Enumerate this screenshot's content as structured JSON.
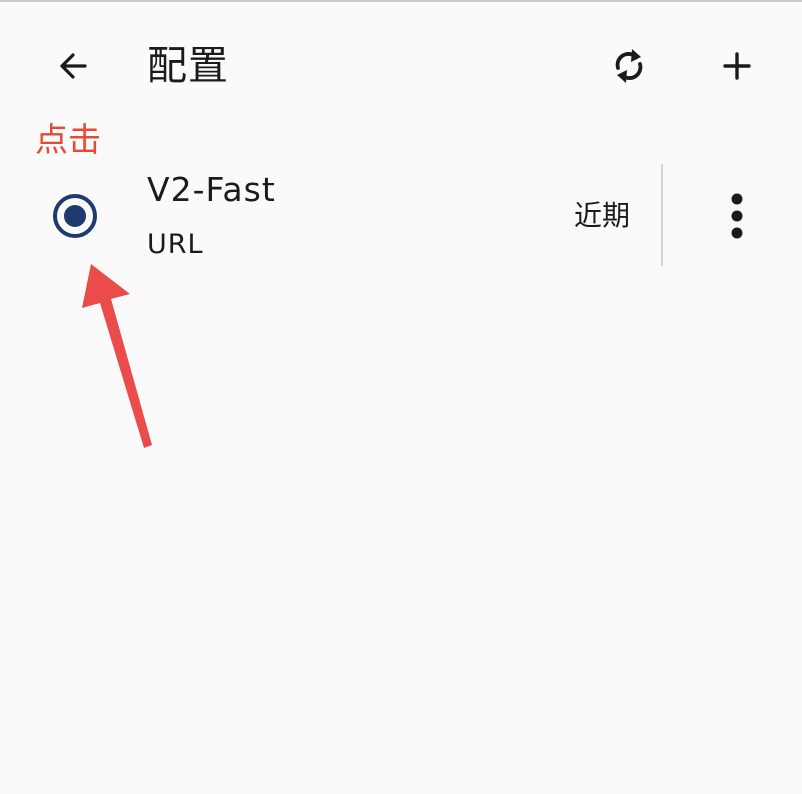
{
  "app_bar": {
    "title": "配置",
    "back_icon": "arrow-left-icon",
    "sync_icon": "sync-icon",
    "add_icon": "plus-icon"
  },
  "annotation": {
    "label": "点击",
    "color": "#e64a32",
    "arrow_icon": "annotation-arrow"
  },
  "profiles": [
    {
      "name": "V2-Fast",
      "type": "URL",
      "updated": "近期",
      "selected": true,
      "radio_color": "#1e3a6e",
      "menu_icon": "more-vertical-icon"
    }
  ],
  "colors": {
    "background": "#fafafa",
    "text": "#1b1b1b",
    "divider": "#d4d4d4",
    "accent": "#1e3a6e",
    "annotation": "#e64a32"
  }
}
